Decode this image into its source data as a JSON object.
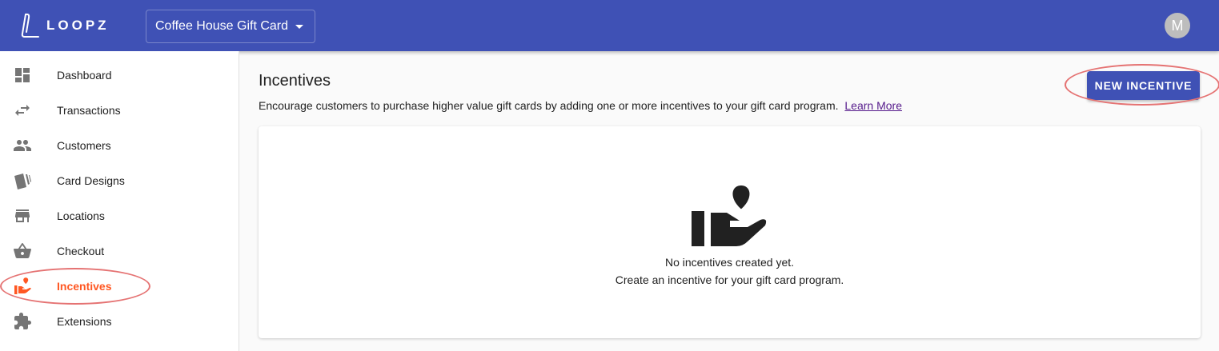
{
  "app": {
    "brand": "LOOPZ",
    "program_selector": "Coffee House Gift Card",
    "avatar_initial": "M",
    "colors": {
      "primary": "#3f51b5",
      "active": "#ff5722",
      "highlight_ring": "#e57373"
    }
  },
  "sidebar": {
    "items": [
      {
        "label": "Dashboard",
        "icon": "dashboard-icon"
      },
      {
        "label": "Transactions",
        "icon": "swap-arrows-icon"
      },
      {
        "label": "Customers",
        "icon": "people-icon"
      },
      {
        "label": "Card Designs",
        "icon": "cards-icon"
      },
      {
        "label": "Locations",
        "icon": "storefront-icon"
      },
      {
        "label": "Checkout",
        "icon": "basket-icon"
      },
      {
        "label": "Incentives",
        "icon": "hand-heart-icon",
        "active": true
      },
      {
        "label": "Extensions",
        "icon": "puzzle-icon"
      }
    ]
  },
  "main": {
    "title": "Incentives",
    "description": "Encourage customers to purchase higher value gift cards by adding one or more incentives to your gift card program.",
    "learn_more": "Learn More",
    "new_button": "NEW INCENTIVE",
    "empty_state": {
      "icon": "hand-heart-icon",
      "line1": "No incentives created yet.",
      "line2": "Create an incentive for your gift card program."
    }
  }
}
